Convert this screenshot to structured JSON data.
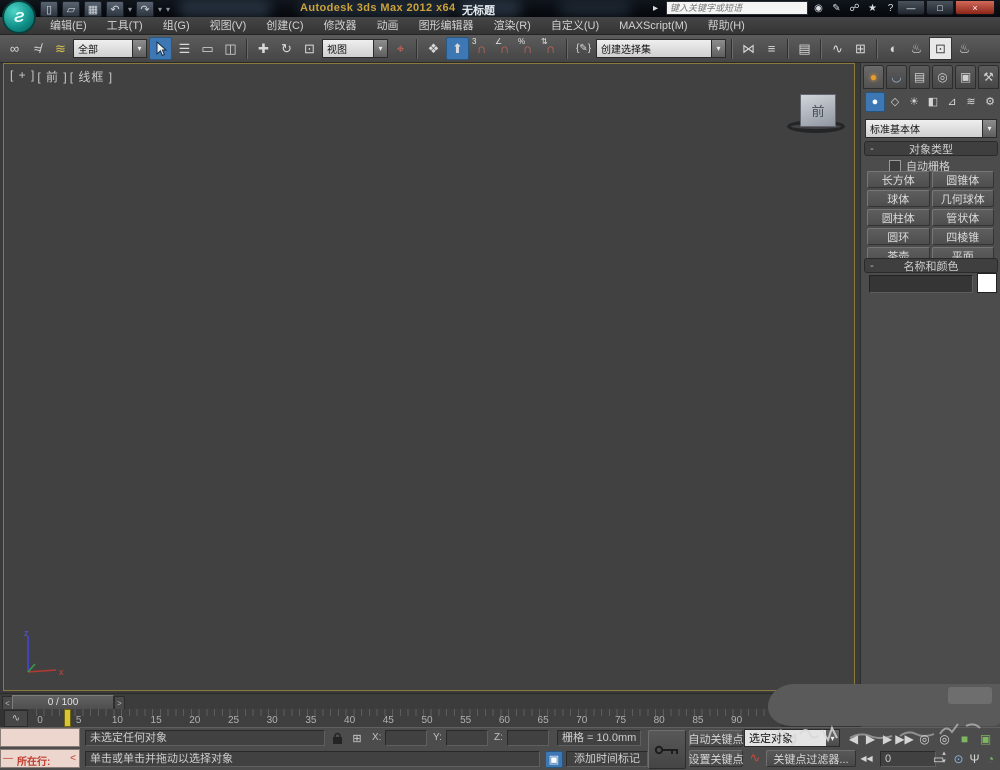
{
  "titlebar": {
    "title": "Autodesk 3ds Max  2012 x64",
    "document": "无标题",
    "search_placeholder": "键入关键字或短语"
  },
  "menubar": {
    "items": [
      "编辑(E)",
      "工具(T)",
      "组(G)",
      "视图(V)",
      "创建(C)",
      "修改器",
      "动画",
      "图形编辑器",
      "渲染(R)",
      "自定义(U)",
      "MAXScript(M)",
      "帮助(H)"
    ]
  },
  "toolbar": {
    "selection_filter": "全部",
    "reference_coordsys": "视图",
    "named_selection_sets": "创建选择集",
    "snap_level": "3"
  },
  "viewport": {
    "label_menu": "[ + ]",
    "label_view": "[ 前 ]",
    "label_shading": "[ 线框 ]",
    "viewcube_face": "前",
    "axis_x": "x",
    "axis_z": "z"
  },
  "command_panel": {
    "category_dropdown": "标准基本体",
    "object_type": {
      "title": "对象类型",
      "collapse": "-",
      "autogrid": "自动栅格",
      "buttons": [
        "长方体",
        "圆锥体",
        "球体",
        "几何球体",
        "圆柱体",
        "管状体",
        "圆环",
        "四棱锥",
        "茶壶",
        "平面"
      ]
    },
    "name_color": {
      "title": "名称和颜色",
      "collapse": "-",
      "name_value": ""
    }
  },
  "timeline": {
    "frame_display": "0 / 100",
    "prev": "<",
    "next": ">",
    "ruler_labels": [
      "0",
      "5",
      "10",
      "15",
      "20",
      "25",
      "30",
      "35",
      "40",
      "45",
      "50",
      "55",
      "60",
      "65",
      "70",
      "75",
      "80",
      "85",
      "90"
    ]
  },
  "statusbar": {
    "selection_status": "未选定任何对象",
    "prompt": "单击或单击并拖动以选择对象",
    "listener_dash": "—",
    "listener_line_label": "所在行:",
    "listener_arrow": "<",
    "x_label": "X:",
    "y_label": "Y:",
    "z_label": "Z:",
    "x_value": "",
    "y_value": "",
    "z_value": "",
    "grid_info": "栅格 = 10.0mm",
    "add_time_tag": "添加时间标记",
    "auto_key": "自动关键点",
    "set_key": "设置关键点",
    "selection_set": "选定对象",
    "key_filters": "关键点过滤器...",
    "frame_field": "0"
  },
  "colors": {
    "accent_blue": "#3d78b4",
    "active_viewport_border": "#8a7a3e",
    "viewport_bg": "#414141",
    "title_gold": "#c9a23a",
    "listener_pink": "#ecd6cd",
    "frame_marker_yellow": "#d8c636"
  },
  "icons": {
    "logo": "Ƨ",
    "dropdown": "▾",
    "new_doc": "▯",
    "open": "▱",
    "save": "▦",
    "undo": "↶",
    "redo": "↷",
    "expand": "▸",
    "search_go": "◉",
    "wrench": "✎",
    "comm_center": "☍",
    "favorites": "★",
    "help": "?",
    "minimize": "—",
    "maximize": "□",
    "close": "×",
    "link": "∞",
    "unlink": "≉",
    "bind": "≋",
    "by_name": "☰",
    "region": "▭",
    "window_cross": "◫",
    "move": "✚",
    "rotate": "↻",
    "scale": "⊡",
    "pivot": "⌖",
    "manipulate": "❖",
    "kbd_override": "⬆",
    "magnet": "∩",
    "angle": "∠",
    "percent": "%",
    "spinner_snap": "⇅",
    "edit_sets": "{✎}",
    "mirror": "⋈",
    "align": "≡",
    "layers": "▤",
    "curve_editor": "∿",
    "schematic": "⊞",
    "material": "◐",
    "render_setup": "♨",
    "render_frame": "⊡",
    "render": "♨",
    "tab_create": "●",
    "tab_modify": "◡",
    "tab_hierarchy": "▤",
    "tab_motion": "◎",
    "tab_display": "▣",
    "tab_utilities": "⚒",
    "geometry": "●",
    "shapes": "◇",
    "lights": "☀",
    "cameras": "◧",
    "helpers": "⊿",
    "spacewarps": "≋",
    "systems": "⚙",
    "mini_curve": "∿",
    "abs_mode": "⊞",
    "set_key_curve": "∿",
    "sel_lock": "▣",
    "goto_start": "◀◀",
    "prev_key": "◀",
    "play": "▶",
    "next_key": "▶",
    "goto_end": "▶▶",
    "spin_up": "▴",
    "spin_dn": "▾",
    "time_config": "⊙",
    "zoom": "◎",
    "zoom_all": "◎",
    "zoom_extents": "■",
    "zoom_extents_all": "▣",
    "zoom_region": "▭",
    "pan_hand": "Ψ",
    "orbit": "◔",
    "max_viewport": "⊞"
  }
}
